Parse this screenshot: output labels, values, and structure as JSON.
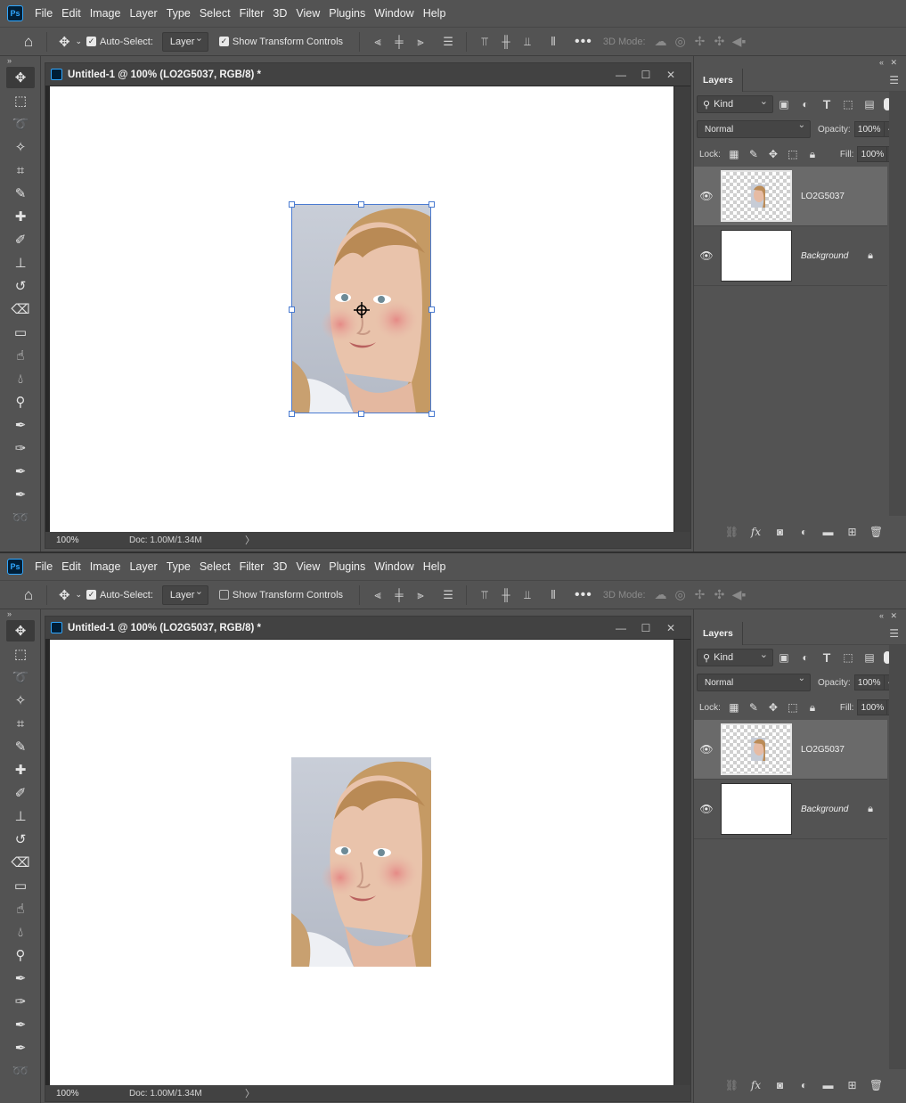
{
  "menu": {
    "logo": "Ps",
    "items": [
      "File",
      "Edit",
      "Image",
      "Layer",
      "Type",
      "Select",
      "Filter",
      "3D",
      "View",
      "Plugins",
      "Window",
      "Help"
    ]
  },
  "screens": [
    {
      "options": {
        "auto_select_label": "Auto-Select:",
        "auto_select_checked": true,
        "layer_select": "Layer",
        "show_transform_label": "Show Transform Controls",
        "show_transform_checked": true,
        "mode_label": "3D Mode:"
      },
      "document": {
        "title": "Untitled-1 @ 100% (LO2G5037, RGB/8) *",
        "zoom": "100%",
        "doc_info": "Doc: 1.00M/1.34M",
        "transform_box_visible": true
      },
      "layers_panel": {
        "tab": "Layers",
        "kind_label": "Kind",
        "blend_mode": "Normal",
        "opacity_label": "Opacity:",
        "opacity_value": "100%",
        "lock_label": "Lock:",
        "fill_label": "Fill:",
        "fill_value": "100%",
        "layers": [
          {
            "name": "LO2G5037",
            "selected": true,
            "locked": false
          },
          {
            "name": "Background",
            "selected": false,
            "locked": true
          }
        ]
      }
    },
    {
      "options": {
        "auto_select_label": "Auto-Select:",
        "auto_select_checked": true,
        "layer_select": "Layer",
        "show_transform_label": "Show Transform Controls",
        "show_transform_checked": false,
        "mode_label": "3D Mode:"
      },
      "document": {
        "title": "Untitled-1 @ 100% (LO2G5037, RGB/8) *",
        "zoom": "100%",
        "doc_info": "Doc: 1.00M/1.34M",
        "transform_box_visible": false
      },
      "layers_panel": {
        "tab": "Layers",
        "kind_label": "Kind",
        "blend_mode": "Normal",
        "opacity_label": "Opacity:",
        "opacity_value": "100%",
        "lock_label": "Lock:",
        "fill_label": "Fill:",
        "fill_value": "100%",
        "layers": [
          {
            "name": "LO2G5037",
            "selected": true,
            "locked": false
          },
          {
            "name": "Background",
            "selected": false,
            "locked": true
          }
        ]
      }
    }
  ],
  "colors": {
    "ui_bg": "#535353",
    "accent": "#1473e6",
    "transform_box": "#4a7bd1",
    "canvas": "#ffffff"
  },
  "icons": {
    "tools": [
      "move-tool-icon",
      "marquee-tool-icon",
      "lasso-tool-icon",
      "magic-wand-icon",
      "crop-tool-icon",
      "eyedropper-icon",
      "healing-brush-icon",
      "brush-tool-icon",
      "clone-stamp-icon",
      "history-brush-icon",
      "eraser-icon",
      "gradient-tool-icon",
      "smudge-tool-icon",
      "blur-tool-icon",
      "dodge-tool-icon",
      "pen-tool-icon",
      "freeform-pen-icon",
      "curvature-pen-icon",
      "add-anchor-icon",
      "content-aware-tracing-icon"
    ]
  }
}
